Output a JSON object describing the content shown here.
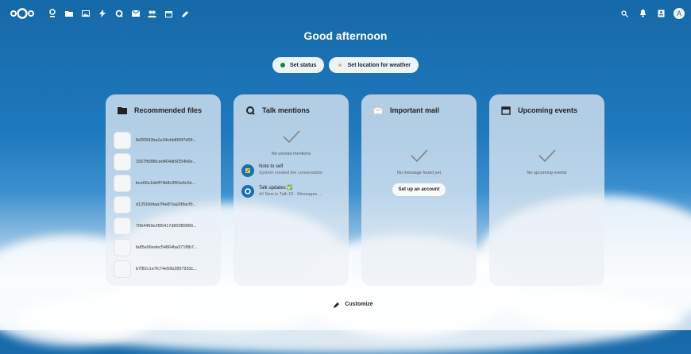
{
  "topbar": {
    "apps": [
      "dashboard-icon",
      "files-icon",
      "photos-icon",
      "activity-icon",
      "talk-icon",
      "mail-icon",
      "contacts-icon",
      "calendar-icon",
      "notes-icon"
    ],
    "right": [
      "search-icon",
      "notifications-icon",
      "contacts-menu-icon"
    ],
    "avatar_letter": "A"
  },
  "greeting": "Good afternoon",
  "status": {
    "set_status": "Set status",
    "set_location": "Set location for weather"
  },
  "widgets": {
    "files": {
      "title": "Recommended files",
      "items": [
        "8d20592ba1e34cbb865f7d09...",
        "1567fb986ced404db9254b6e...",
        "bce66e1bbff74b8c9f91e6c6e...",
        "d1291bbfaa7f4e87aa2d9acf9...",
        "7064459e2f95417d803f09f90...",
        "fa85e96edec54864ba371f8b7...",
        "b7f82c1e7fc74e56b2857933c..."
      ]
    },
    "talk": {
      "title": "Talk mentions",
      "empty": "No unread mentions",
      "messages": [
        {
          "title": "Note to self",
          "subtitle": "System created the conversation"
        },
        {
          "title": "Talk updates ✅",
          "subtitle": "## New in Talk 19 - Messages ..."
        }
      ]
    },
    "mail": {
      "title": "Important mail",
      "empty": "No message found yet",
      "button": "Set up an account"
    },
    "events": {
      "title": "Upcoming events",
      "empty": "No upcoming events"
    }
  },
  "customize": "Customize",
  "colors": {
    "accent": "#1669a8",
    "green": "#2d7b3f"
  }
}
